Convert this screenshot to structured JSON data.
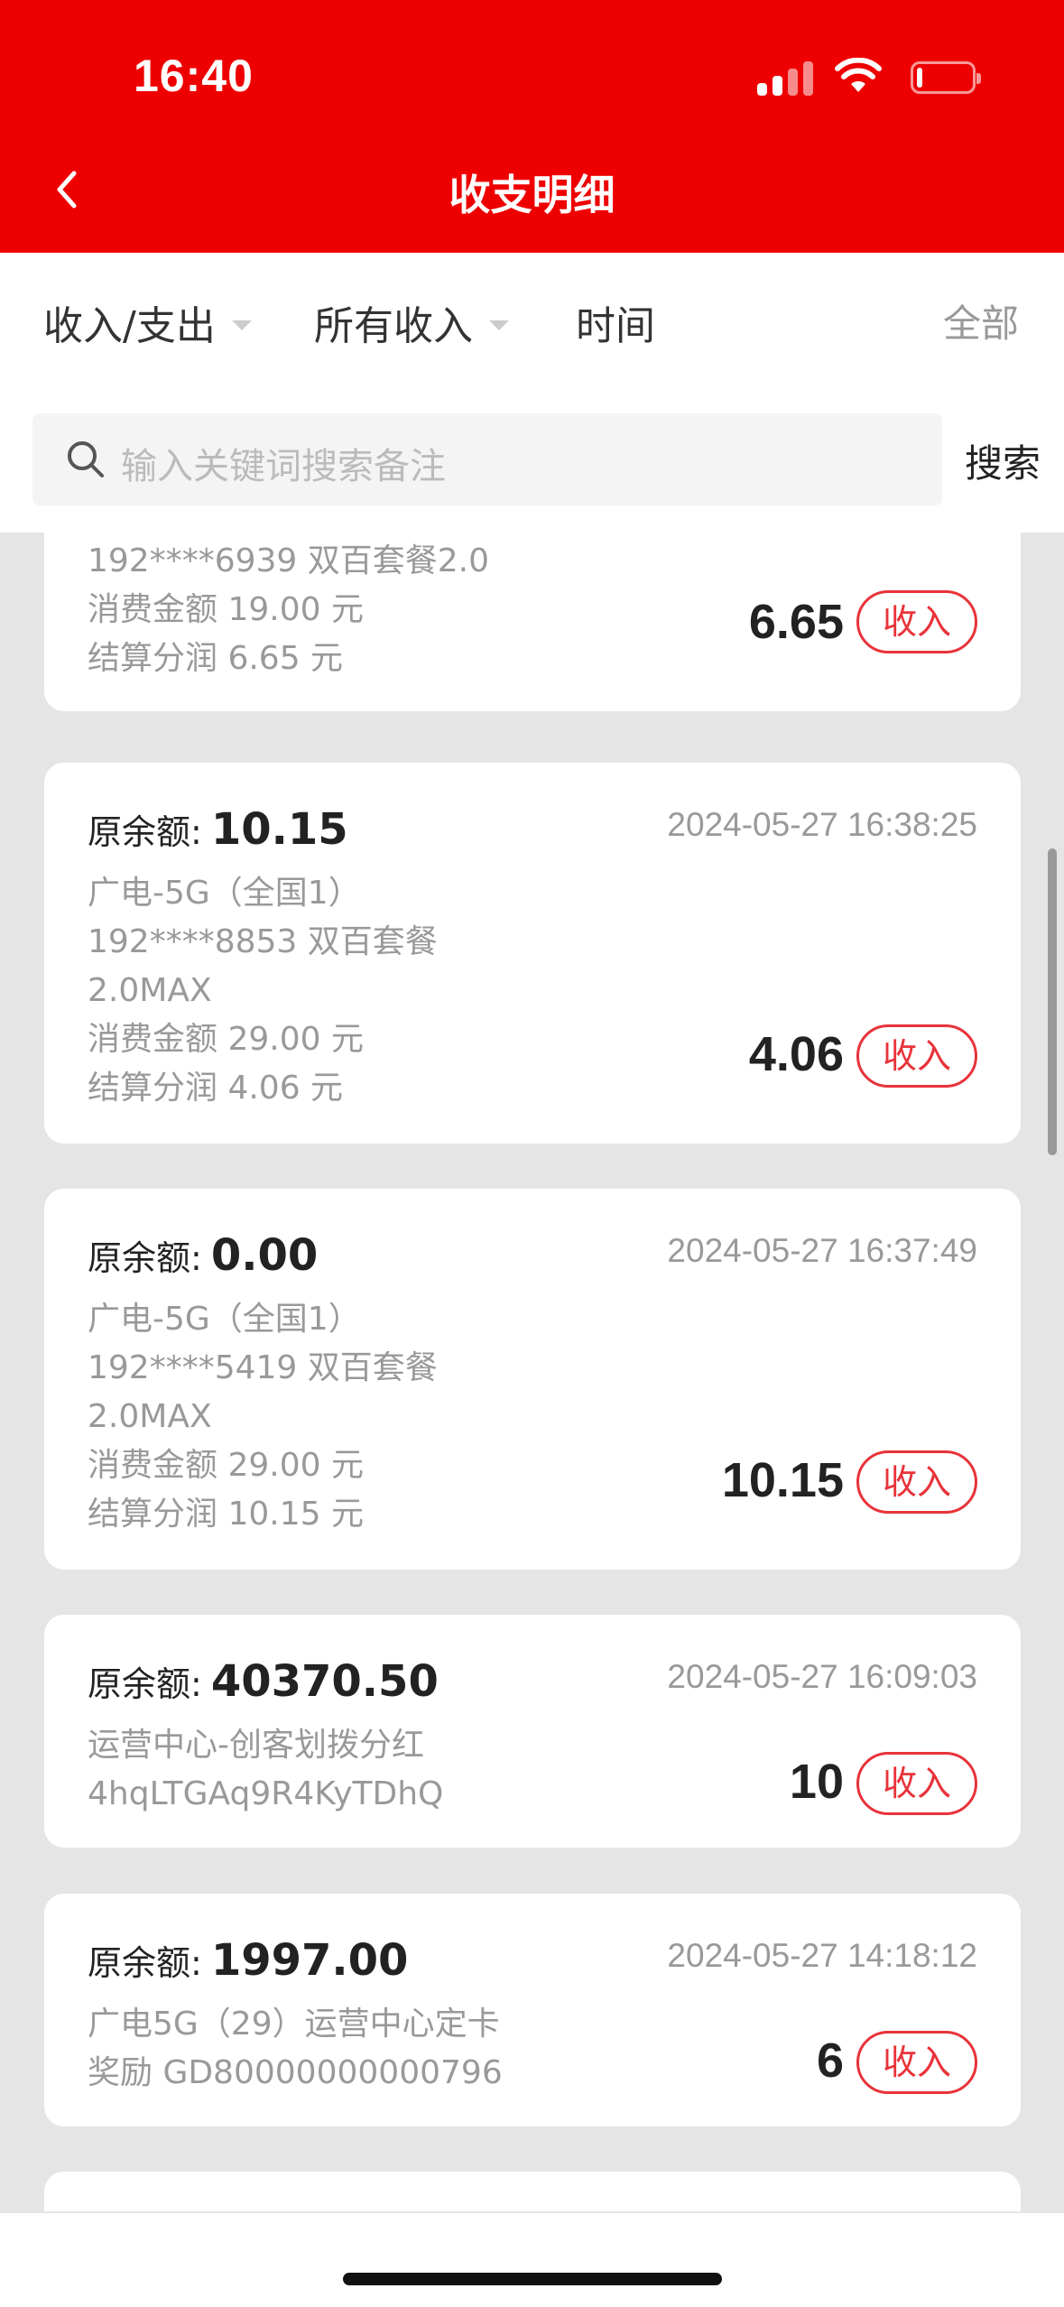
{
  "status_bar": {
    "time": "16:40"
  },
  "nav": {
    "title": "收支明细"
  },
  "filters": {
    "type_label": "收入/支出",
    "category_label": "所有收入",
    "time_label": "时间",
    "all_label": "全部"
  },
  "search": {
    "placeholder": "输入关键词搜索备注",
    "button_label": "搜索"
  },
  "colors": {
    "brand_red": "#ee0000",
    "tag_red": "#e8333a"
  },
  "records": [
    {
      "desc": [
        "192****6939 双百套餐2.0",
        "消费金额 19.00 元",
        "结算分润 6.65 元"
      ],
      "amount": "6.65",
      "tag": "收入"
    },
    {
      "balance_label": "原余额:",
      "balance": "10.15",
      "datetime": "2024-05-27 16:38:25",
      "desc": [
        "广电-5G（全国1）",
        "192****8853 双百套餐",
        "2.0MAX",
        "消费金额 29.00 元",
        "结算分润 4.06 元"
      ],
      "amount": "4.06",
      "tag": "收入"
    },
    {
      "balance_label": "原余额:",
      "balance": "0.00",
      "datetime": "2024-05-27 16:37:49",
      "desc": [
        "广电-5G（全国1）",
        "192****5419 双百套餐",
        "2.0MAX",
        "消费金额 29.00 元",
        "结算分润 10.15 元"
      ],
      "amount": "10.15",
      "tag": "收入"
    },
    {
      "balance_label": "原余额:",
      "balance": "40370.50",
      "datetime": "2024-05-27 16:09:03",
      "desc": [
        "运营中心-创客划拨分红",
        "4hqLTGAq9R4KyTDhQ"
      ],
      "amount": "10",
      "tag": "收入"
    },
    {
      "balance_label": "原余额:",
      "balance": "1997.00",
      "datetime": "2024-05-27 14:18:12",
      "desc": [
        "广电5G（29）运营中心定卡",
        "奖励 GD80000000000796"
      ],
      "amount": "6",
      "tag": "收入"
    }
  ]
}
